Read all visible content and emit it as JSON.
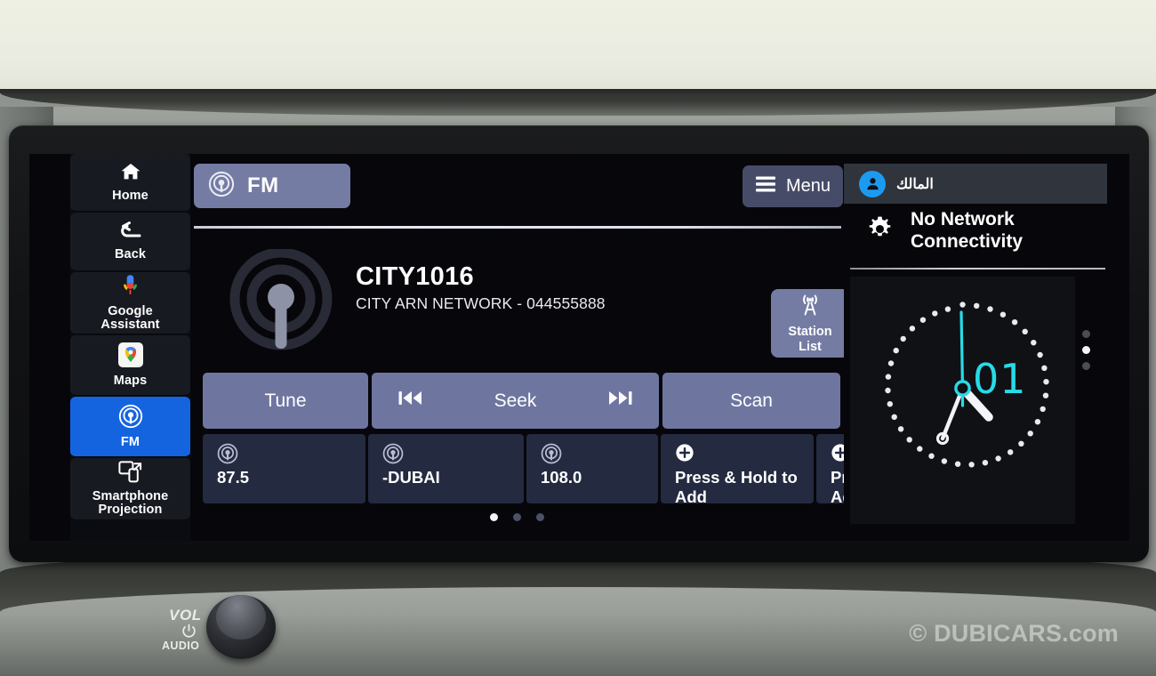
{
  "environment": {
    "volume_knob": {
      "vol_label": "VOL",
      "audio_label": "AUDIO",
      "power_icon": "power-icon"
    },
    "watermark": "© DUBICARS.com"
  },
  "sidebar": {
    "items": [
      {
        "label": "Home",
        "icon": "home-icon",
        "active": false
      },
      {
        "label": "Back",
        "icon": "back-arrow-icon",
        "active": false
      },
      {
        "label": "Google\nAssistant",
        "label_line1": "Google",
        "label_line2": "Assistant",
        "icon": "google-assistant-mic-icon",
        "active": false
      },
      {
        "label": "Maps",
        "icon": "google-maps-pin-icon",
        "active": false
      },
      {
        "label": "FM",
        "icon": "radio-broadcast-icon",
        "active": true
      },
      {
        "label": "Smartphone\nProjection",
        "label_line1": "Smartphone",
        "label_line2": "Projection",
        "icon": "smartphone-projection-icon",
        "active": false
      }
    ],
    "active_color": "#1464E0"
  },
  "main": {
    "source_tab": {
      "label": "FM",
      "icon": "radio-broadcast-icon"
    },
    "menu_button": {
      "label": "Menu",
      "icon": "hamburger-menu-icon"
    },
    "now_playing": {
      "station_name": "CITY1016",
      "station_info": "CITY ARN NETWORK - 044555888",
      "artwork_icon": "radio-broadcast-icon"
    },
    "station_list_button": {
      "line1": "Station",
      "line2": "List",
      "icon": "radio-tower-icon"
    },
    "controls": [
      {
        "label": "Tune",
        "name": "tune"
      },
      {
        "label": "Seek",
        "name": "seek",
        "prev_icon": "skip-previous-icon",
        "next_icon": "skip-next-icon"
      },
      {
        "label": "Scan",
        "name": "scan"
      }
    ],
    "presets": [
      {
        "label": "87.5",
        "icon": "radio-broadcast-icon"
      },
      {
        "label": "-DUBAI",
        "icon": "radio-broadcast-icon"
      },
      {
        "label": "108.0",
        "icon": "radio-broadcast-icon"
      },
      {
        "label": "Press & Hold to Add",
        "icon": "plus-circle-icon"
      },
      {
        "label": "Press & Hold to Add",
        "icon": "plus-circle-icon"
      }
    ],
    "page_indicator": {
      "total": 3,
      "active_index": 0
    }
  },
  "right_panel": {
    "user": {
      "name": "المالك",
      "icon": "user-avatar-icon"
    },
    "status": {
      "line1": "No Network",
      "line2": "Connectivity",
      "icon": "gear-icon"
    },
    "clock": {
      "label": "01",
      "accent_color": "#27dbe8"
    },
    "page_indicator": {
      "total": 3,
      "active_index": 1
    }
  }
}
